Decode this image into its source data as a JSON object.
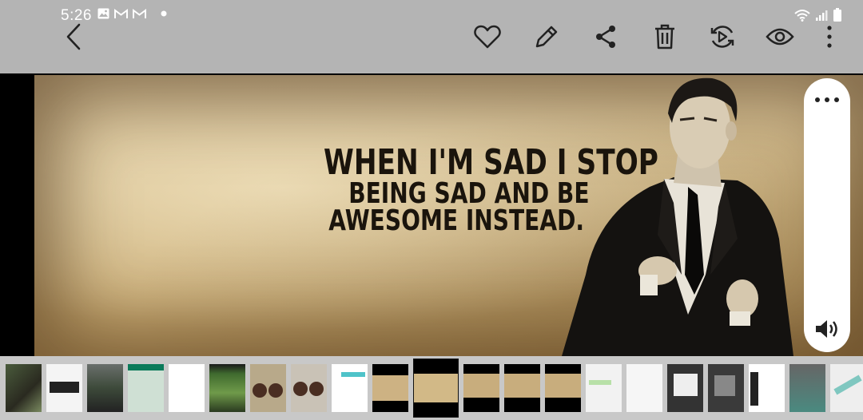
{
  "status_bar": {
    "time": "5:26",
    "notification_icons": [
      "gallery-icon",
      "gmail-icon",
      "gmail-icon",
      "dot-icon"
    ],
    "system_icons": [
      "wifi-icon",
      "signal-icon",
      "battery-icon"
    ]
  },
  "toolbar": {
    "actions": [
      "back-icon",
      "heart-icon",
      "edit-icon",
      "share-icon",
      "delete-icon",
      "rotate-icon",
      "eye-icon",
      "more-vert-icon"
    ]
  },
  "image": {
    "quote_line1": "WHEN I'M SAD I STOP",
    "quote_line2": "BEING SAD AND BE",
    "quote_line3": "AWESOME INSTEAD."
  },
  "side_panel": {
    "top_icon": "more-horiz-icon",
    "bottom_icon": "volume-icon"
  },
  "filmstrip": {
    "selected_index": 10,
    "thumb_count": 21
  },
  "colors": {
    "toolbar_bg": "#b4b4b4",
    "icon": "#222222",
    "filmstrip_bg": "#c8c8c8"
  }
}
